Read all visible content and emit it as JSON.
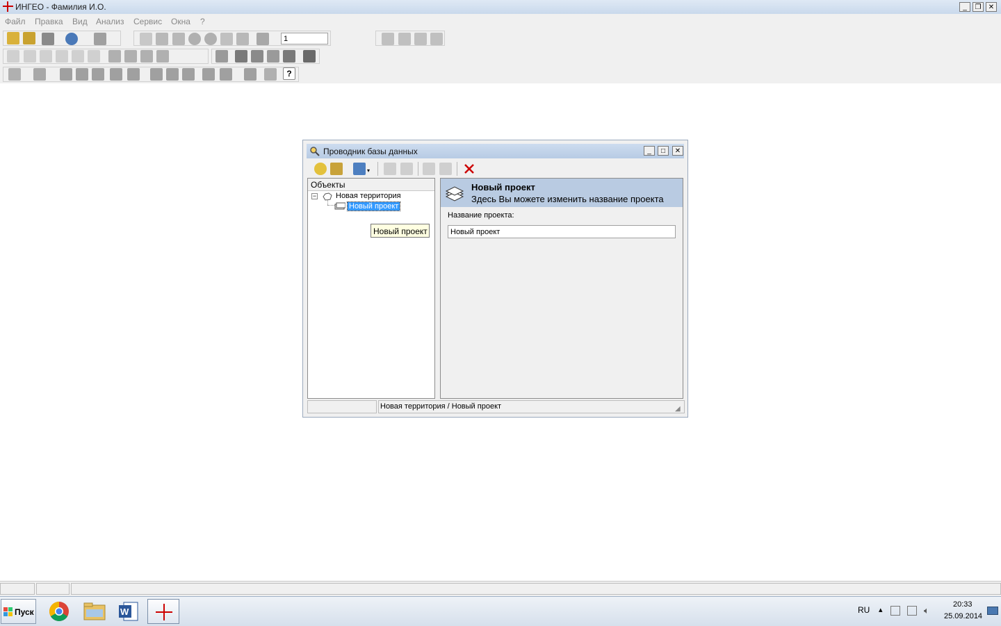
{
  "window": {
    "title": "ИНГЕО - Фамилия И.О."
  },
  "menu": [
    "Файл",
    "Правка",
    "Вид",
    "Анализ",
    "Сервис",
    "Окна",
    "?"
  ],
  "toolbar": {
    "scale_value": "1"
  },
  "dialog": {
    "title": "Проводник базы данных",
    "tree_header": "Объекты",
    "tree": {
      "root": "Новая территория",
      "child": "Новый проект"
    },
    "tooltip": "Новый проект",
    "panel_title": "Новый проект",
    "panel_subtitle": "Здесь Вы можете изменить название проекта",
    "field_label": "Название проекта:",
    "field_value": "Новый проект",
    "status_path": "Новая территория / Новый проект"
  },
  "taskbar": {
    "start_label": "Пуск",
    "lang": "RU",
    "time": "20:33",
    "date": "25.09.2014"
  },
  "colors": {
    "accent": "#3399ff",
    "dialog_header": "#b9cbe2",
    "tooltip": "#ffffe1",
    "delete": "#cc0000"
  }
}
